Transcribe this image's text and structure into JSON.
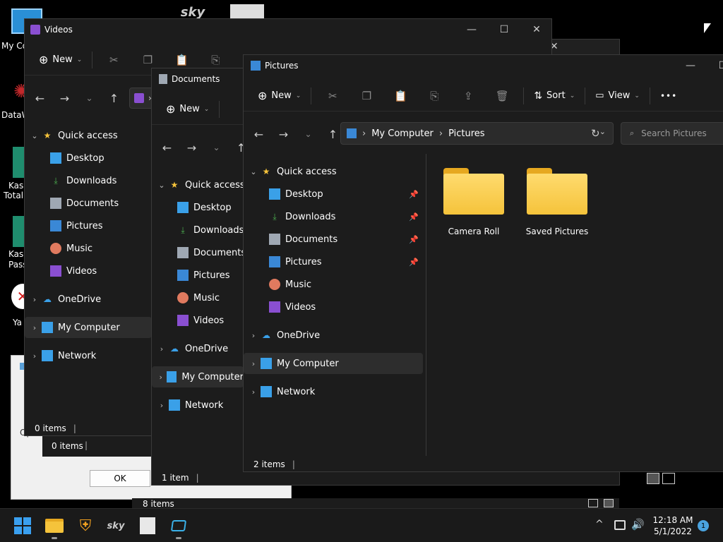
{
  "desktop": {
    "icons": [
      {
        "label": "My Co"
      },
      {
        "label": "DataW"
      },
      {
        "label": "Kasp"
      },
      {
        "label": "Total S"
      },
      {
        "label": "Kasp"
      },
      {
        "label": "Pass"
      },
      {
        "label": "Ya"
      }
    ]
  },
  "dialog": {
    "ok_label": "OK",
    "status_text": "8 items",
    "partial_label": "Ope"
  },
  "videos_window": {
    "title": "Videos",
    "new_label": "New",
    "status_text": "0 items",
    "nav": [
      {
        "label": "Quick access"
      },
      {
        "label": "Desktop"
      },
      {
        "label": "Downloads"
      },
      {
        "label": "Documents"
      },
      {
        "label": "Pictures"
      },
      {
        "label": "Music"
      },
      {
        "label": "Videos"
      },
      {
        "label": "OneDrive"
      },
      {
        "label": "My Computer"
      },
      {
        "label": "Network"
      }
    ],
    "behind_status_text": "0 items"
  },
  "documents_window": {
    "title": "Documents",
    "new_label": "New",
    "status_text": "1 item",
    "nav": [
      {
        "label": "Quick access"
      },
      {
        "label": "Desktop"
      },
      {
        "label": "Downloads"
      },
      {
        "label": "Documents"
      },
      {
        "label": "Pictures"
      },
      {
        "label": "Music"
      },
      {
        "label": "Videos"
      },
      {
        "label": "OneDrive"
      },
      {
        "label": "My Computer"
      },
      {
        "label": "Network"
      }
    ]
  },
  "pictures_window": {
    "title": "Pictures",
    "new_label": "New",
    "sort_label": "Sort",
    "view_label": "View",
    "more_label": "•••",
    "breadcrumb": [
      "My Computer",
      "Pictures"
    ],
    "search_placeholder": "Search Pictures",
    "nav": [
      {
        "label": "Quick access"
      },
      {
        "label": "Desktop"
      },
      {
        "label": "Downloads"
      },
      {
        "label": "Documents"
      },
      {
        "label": "Pictures"
      },
      {
        "label": "Music"
      },
      {
        "label": "Videos"
      },
      {
        "label": "OneDrive"
      },
      {
        "label": "My Computer"
      },
      {
        "label": "Network"
      }
    ],
    "folders": [
      {
        "name": "Camera Roll"
      },
      {
        "name": "Saved Pictures"
      }
    ],
    "status_text": "2 items"
  },
  "taskbar": {
    "time": "12:18 AM",
    "date": "5/1/2022",
    "notification_count": "1"
  },
  "colors": {
    "folder": "#f5c33b",
    "accent": "#0078d4",
    "window_bg": "#1c1c1c"
  }
}
